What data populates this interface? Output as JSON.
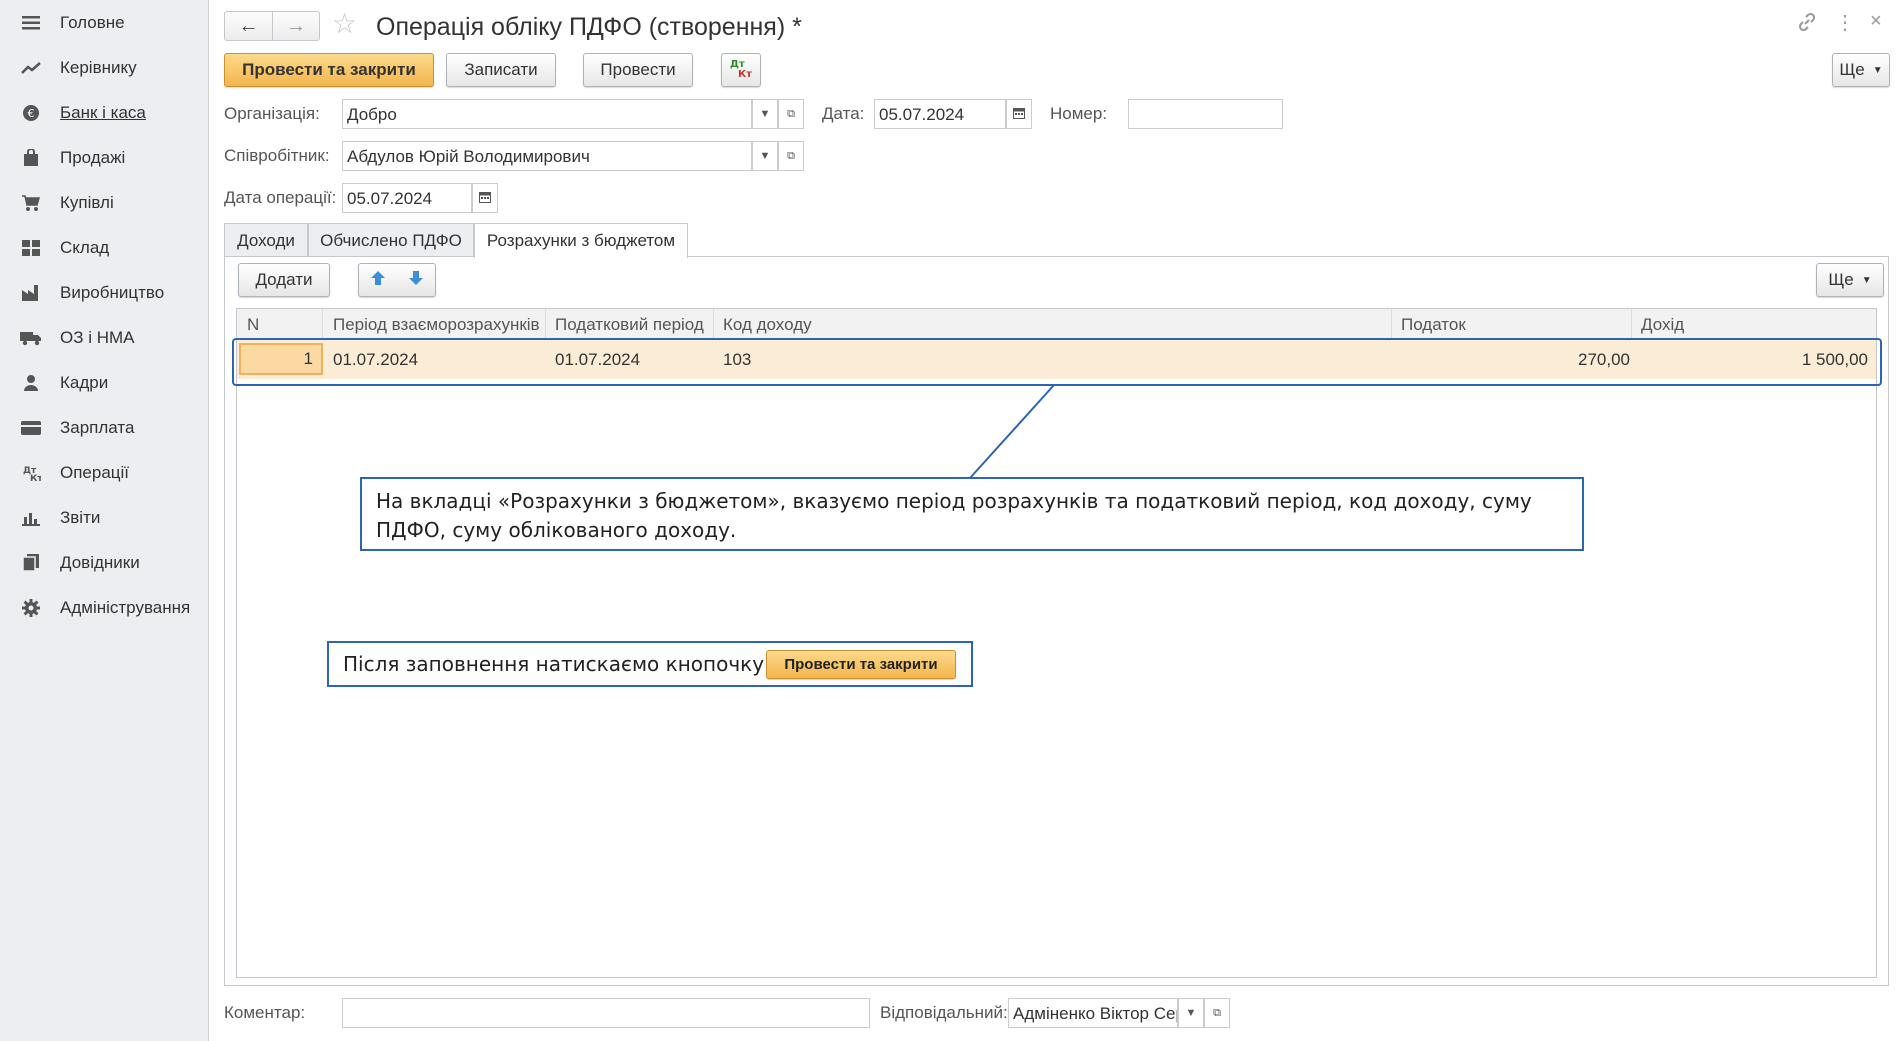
{
  "sidebar": {
    "items": [
      {
        "label": "Головне",
        "icon": "menu-icon"
      },
      {
        "label": "Керівнику",
        "icon": "trend-icon"
      },
      {
        "label": "Банк і каса",
        "icon": "coin-icon"
      },
      {
        "label": "Продажі",
        "icon": "bag-icon"
      },
      {
        "label": "Купівлі",
        "icon": "cart-icon"
      },
      {
        "label": "Склад",
        "icon": "grid-icon"
      },
      {
        "label": "Виробництво",
        "icon": "factory-icon"
      },
      {
        "label": "ОЗ і НМА",
        "icon": "truck-icon"
      },
      {
        "label": "Кадри",
        "icon": "person-icon"
      },
      {
        "label": "Зарплата",
        "icon": "wallet-icon"
      },
      {
        "label": "Операції",
        "icon": "dt-kt-icon"
      },
      {
        "label": "Звіти",
        "icon": "bar-chart-icon"
      },
      {
        "label": "Довідники",
        "icon": "books-icon"
      },
      {
        "label": "Адміністрування",
        "icon": "gear-icon"
      }
    ]
  },
  "header": {
    "title": "Операція обліку ПДФО (створення) *"
  },
  "toolbar": {
    "post_close": "Провести та закрити",
    "save": "Записати",
    "post": "Провести",
    "more": "Ще"
  },
  "form": {
    "org_label": "Організація:",
    "org_value": "Добро",
    "date_label": "Дата:",
    "date_value": "05.07.2024",
    "number_label": "Номер:",
    "number_value": "",
    "employee_label": "Співробітник:",
    "employee_value": "Абдулов Юрій Володимирович",
    "op_date_label": "Дата операції:",
    "op_date_value": "05.07.2024"
  },
  "tabs": [
    {
      "label": "Доходи"
    },
    {
      "label": "Обчислено ПДФО"
    },
    {
      "label": "Розрахунки з бюджетом"
    }
  ],
  "table_toolbar": {
    "add": "Додати",
    "more": "Ще"
  },
  "table": {
    "columns": [
      "N",
      "Період взаєморозрахунків",
      "Податковий період",
      "Код доходу",
      "Податок",
      "Дохід"
    ],
    "rows": [
      {
        "n": "1",
        "period": "01.07.2024",
        "tax_period": "01.07.2024",
        "code": "103",
        "tax": "270,00",
        "income": "1 500,00"
      }
    ]
  },
  "annotations": {
    "callout1": "На вкладці «Розрахунки з бюджетом», вказуємо період розрахунків та податковий період, код доходу, суму ПДФО, суму облікованого доходу.",
    "callout2": "Після заповнення натискаємо кнопочку",
    "callout2_button": "Провести та закрити"
  },
  "footer": {
    "comment_label": "Коментар:",
    "comment_value": "",
    "responsible_label": "Відповідальний:",
    "responsible_value": "Адміненко Віктор Сергійович"
  },
  "colors": {
    "accent": "#f3b64d",
    "callout_border": "#2f64b4",
    "row_highlight": "#fbecd6"
  }
}
